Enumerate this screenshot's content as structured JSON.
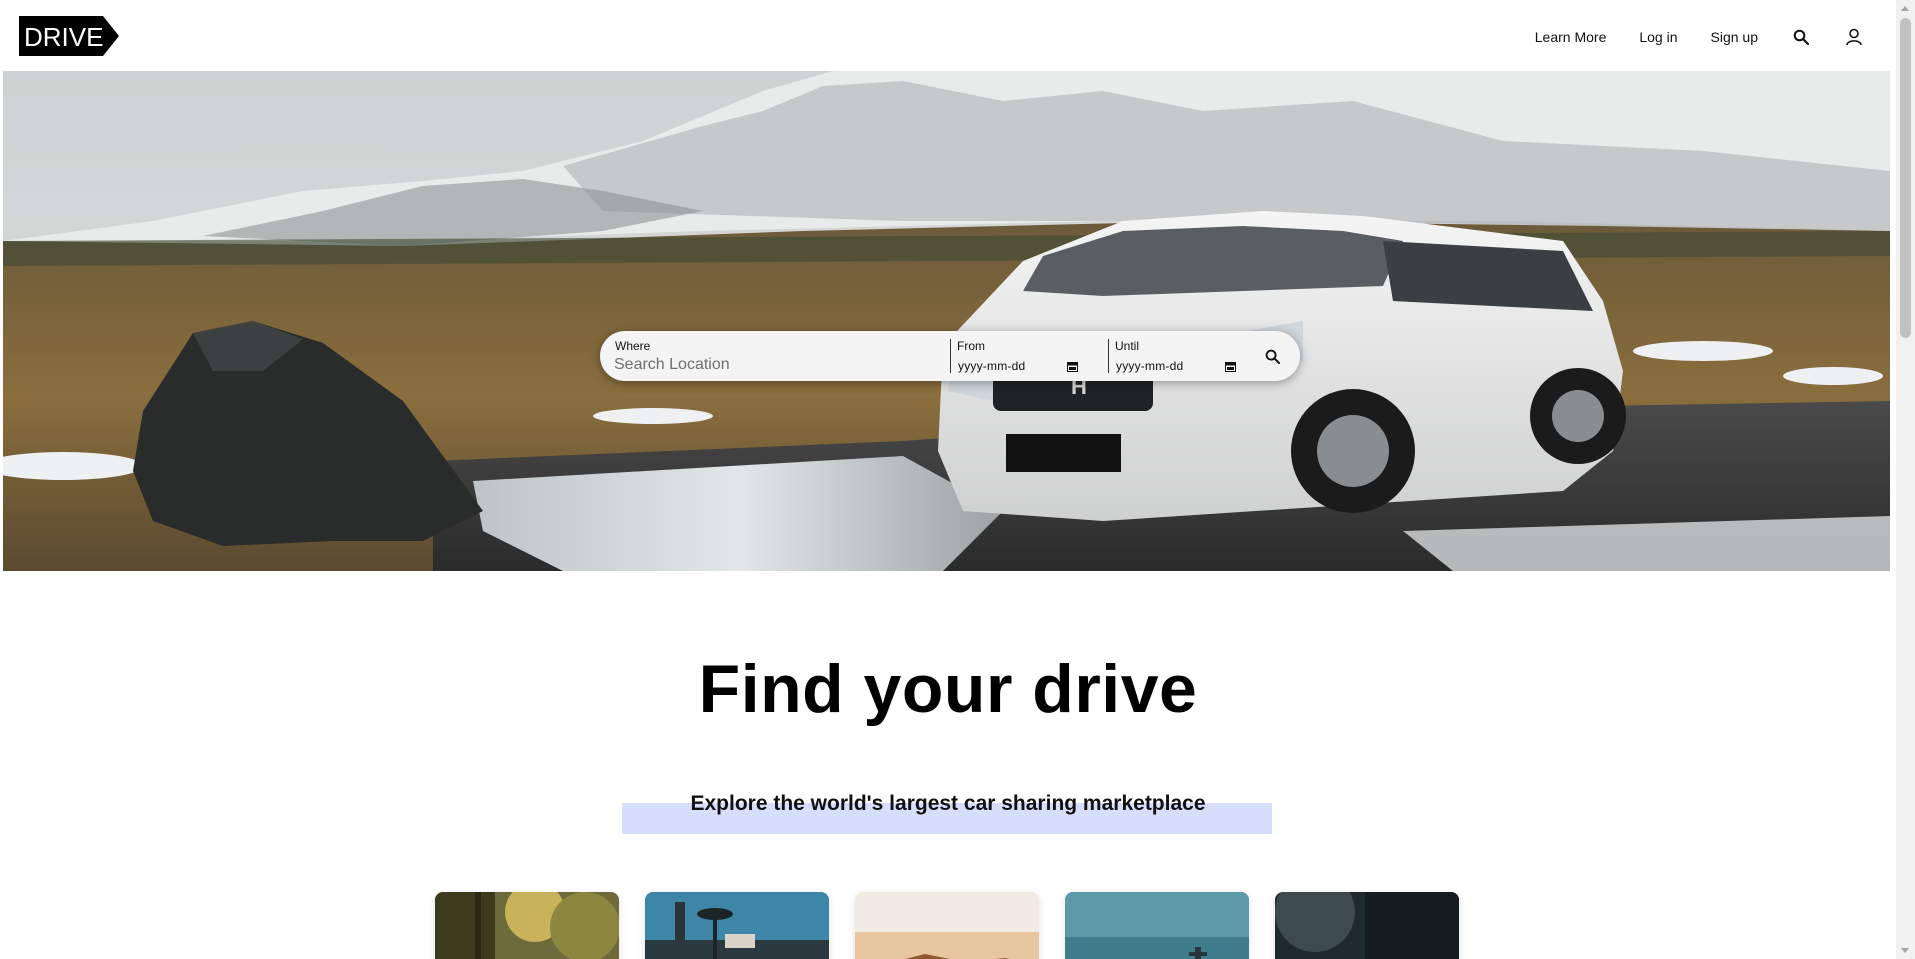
{
  "header": {
    "logo_text": "DRIVE",
    "nav": {
      "learn_more": "Learn More",
      "log_in": "Log in",
      "sign_up": "Sign up"
    },
    "icons": {
      "search": "search-icon",
      "account": "user-icon"
    }
  },
  "search": {
    "where_label": "Where",
    "where_placeholder": "Search Location",
    "from_label": "From",
    "from_value": "yyyy-mm-dd",
    "until_label": "Until",
    "until_value": "yyyy-mm-dd",
    "submit_icon": "search-icon"
  },
  "main": {
    "headline": "Find your drive",
    "subheadline": "Explore the world's largest car sharing marketplace",
    "highlight_color": "#d7defc"
  },
  "hero": {
    "badge_text": "H"
  },
  "cards": [
    {
      "name": "card-forest"
    },
    {
      "name": "card-palms"
    },
    {
      "name": "card-desert"
    },
    {
      "name": "card-coast"
    },
    {
      "name": "card-night"
    }
  ]
}
